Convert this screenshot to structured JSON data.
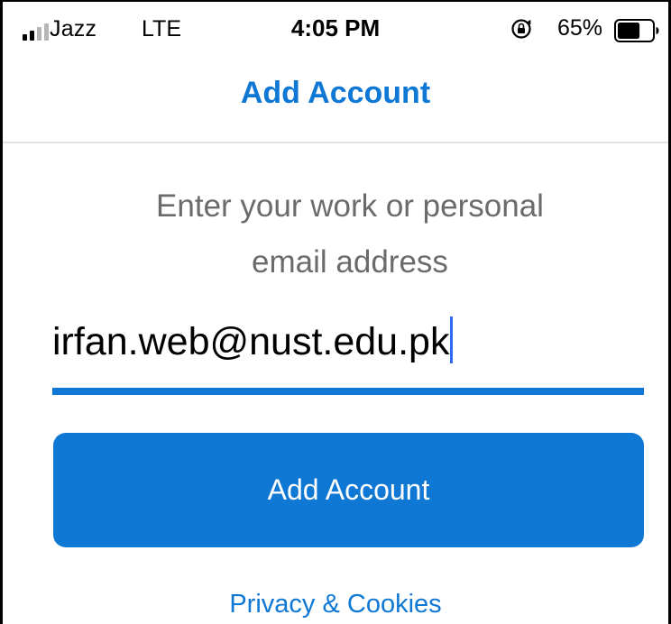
{
  "status_bar": {
    "carrier": "Jazz",
    "network": "LTE",
    "time": "4:05 PM",
    "battery_percent": "65%",
    "battery_level": 0.65,
    "signal_bars_active": 2,
    "signal_bars_total": 4,
    "orientation_icon": "rotation-lock-icon"
  },
  "header": {
    "title": "Add Account"
  },
  "form": {
    "prompt_line1": "Enter your work or personal",
    "prompt_line2": "email address",
    "email_value": "irfan.web@nust.edu.pk",
    "submit_label": "Add Account",
    "privacy_link": "Privacy & Cookies"
  },
  "colors": {
    "accent": "#0f78d4",
    "prompt_text": "#6b6b6b",
    "caret": "#3368f0"
  }
}
